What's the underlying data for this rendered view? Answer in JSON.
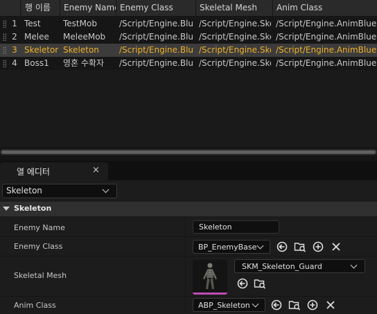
{
  "table": {
    "columns": [
      "행 이름",
      "Enemy Name",
      "Enemy Class",
      "Skeletal Mesh",
      "Anim Class"
    ],
    "rows": [
      {
        "num": "1",
        "row_name": "Test",
        "enemy_name": "TestMob",
        "enemy_class": "/Script/Engine.Bluep",
        "skeletal_mesh": "/Script/Engine.Skel",
        "anim_class": "/Script/Engine.AnimBlueprint"
      },
      {
        "num": "2",
        "row_name": "Melee",
        "enemy_name": "MeleeMob",
        "enemy_class": "/Script/Engine.Bluep",
        "skeletal_mesh": "/Script/Engine.Skel",
        "anim_class": "/Script/Engine.AnimBlueprint"
      },
      {
        "num": "3",
        "row_name": "Skeletor",
        "enemy_name": "Skeleton",
        "enemy_class": "/Script/Engine.Bluep",
        "skeletal_mesh": "/Script/Engine.Skel",
        "anim_class": "/Script/Engine.AnimBlueprint"
      },
      {
        "num": "4",
        "row_name": "Boss1",
        "enemy_name": "영혼 수확자",
        "enemy_class": "/Script/Engine.Bluep",
        "skeletal_mesh": "/Script/Engine.Skel",
        "anim_class": "/Script/Engine.AnimBlueprint"
      }
    ],
    "selected_row": 3,
    "selected_color": "#f0b02a"
  },
  "panel": {
    "tab_label": "열 에디터",
    "close_glyph": "×",
    "row_selector_value": "Skeleton",
    "section_title": "Skeleton",
    "properties": {
      "enemy_name": {
        "label": "Enemy Name",
        "value": "Skeleton"
      },
      "enemy_class": {
        "label": "Enemy Class",
        "value": "BP_EnemyBase"
      },
      "skeletal_mesh": {
        "label": "Skeletal Mesh",
        "value": "SKM_Skeleton_Guard"
      },
      "anim_class": {
        "label": "Anim Class",
        "value": "ABP_Skeleton"
      }
    },
    "icons": [
      "use-selected-asset-icon",
      "browse-asset-icon",
      "add-icon",
      "clear-icon"
    ],
    "thumbnail_accent": "#c14cb8"
  }
}
